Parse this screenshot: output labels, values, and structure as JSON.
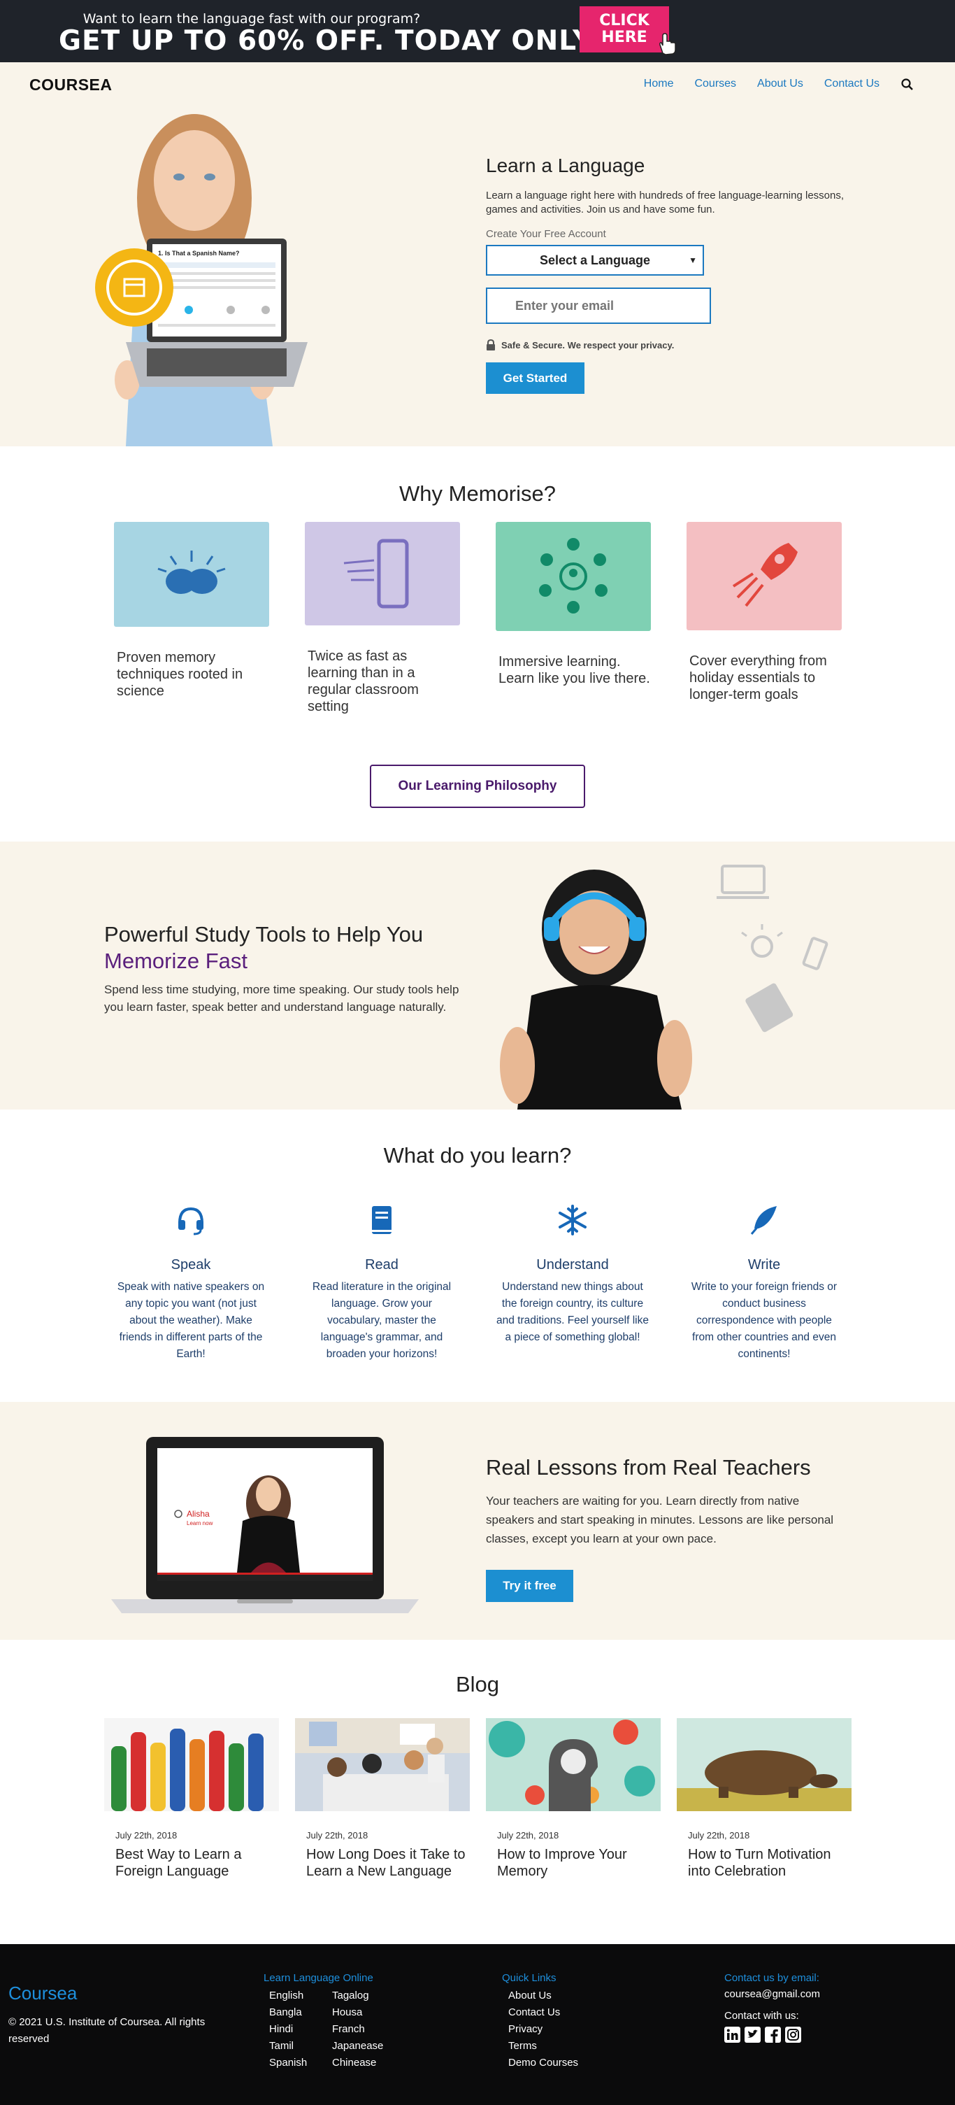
{
  "promo": {
    "subtitle": "Want to learn the language fast with our program?",
    "headline": "GET UP TO 60% OFF. TODAY ONLY!",
    "cta_line1": "CLICK",
    "cta_line2": "HERE"
  },
  "nav": {
    "logo": "COURSEA",
    "items": [
      {
        "label": "Home"
      },
      {
        "label": "Courses"
      },
      {
        "label": "About Us"
      },
      {
        "label": "Contact Us"
      }
    ]
  },
  "hero": {
    "title": "Learn a Language",
    "description": "Learn a language right here with hundreds of free language-learning lessons, games and activities. Join us and have some fun.",
    "create_label": "Create Your Free Account",
    "select_value": "Select a Language",
    "email_placeholder": "Enter your email",
    "safe_text": "Safe & Secure. We respect your privacy.",
    "button": "Get Started",
    "laptop_question": "1. Is That a Spanish Name?"
  },
  "why": {
    "title": "Why Memorise?",
    "cards": [
      {
        "text": "Proven memory techniques rooted in science",
        "color": "#a7d5e3"
      },
      {
        "text": "Twice as fast as learning than in a regular classroom setting",
        "color": "#cfc7e6"
      },
      {
        "text": "Immersive learning. Learn like you live there.",
        "color": "#7fd0b3"
      },
      {
        "text": "Cover everything from holiday essentials to longer-term goals",
        "color": "#f4bfc2"
      }
    ],
    "button": "Our Learning Philosophy"
  },
  "study": {
    "title_line1": "Powerful Study Tools to Help You",
    "title_line2": "Memorize Fast",
    "description": "Spend less time studying, more time speaking. Our study tools help you learn faster, speak better and understand language naturally."
  },
  "learn": {
    "title": "What do you learn?",
    "items": [
      {
        "title": "Speak",
        "text": "Speak with native speakers on any topic you want (not just about the weather). Make friends in different parts of the Earth!",
        "icon": "headset-icon"
      },
      {
        "title": "Read",
        "text": "Read literature in the original language. Grow your vocabulary, master the language's grammar, and broaden your horizons!",
        "icon": "book-icon"
      },
      {
        "title": "Understand",
        "text": "Understand new things about the foreign country, its culture and traditions. Feel yourself like a piece of something global!",
        "icon": "snowflake-icon"
      },
      {
        "title": "Write",
        "text": "Write to your foreign friends or conduct business correspondence with people from other countries and even continents!",
        "icon": "feather-icon"
      }
    ]
  },
  "teach": {
    "title": "Real Lessons from Real Teachers",
    "description": "Your teachers are waiting for you. Learn directly from native speakers and start speaking in minutes. Lessons are like personal classes, except you learn at your own pace.",
    "button": "Try it free",
    "video_label": "Alisha",
    "video_sublabel": "Learn now"
  },
  "blog": {
    "title": "Blog",
    "posts": [
      {
        "date": "July 22th, 2018",
        "title": "Best Way to Learn a Foreign Language"
      },
      {
        "date": "July 22th, 2018",
        "title": "How Long Does it Take to Learn a New Language"
      },
      {
        "date": "July 22th, 2018",
        "title": "How to Improve Your Memory"
      },
      {
        "date": "July 22th, 2018",
        "title": "How to Turn Motivation into Celebration"
      }
    ]
  },
  "footer": {
    "brand": "Coursea",
    "copyright": "© 2021 U.S. Institute of Coursea. All rights reserved",
    "col1_title": "Learn Language Online",
    "col1a": [
      "English",
      "Bangla",
      "Hindi",
      "Tamil",
      "Spanish"
    ],
    "col1b": [
      "Tagalog",
      "Housa",
      "Franch",
      "Japanease",
      "Chinease"
    ],
    "col2_title": "Quick Links",
    "col2": [
      "About Us",
      "Contact Us",
      "Privacy",
      "Terms",
      "Demo Courses"
    ],
    "col3_title": "Contact us by email:",
    "email": "coursea@gmail.com",
    "contact_with": "Contact with us:",
    "socials": [
      "linkedin-icon",
      "twitter-icon",
      "facebook-icon",
      "instagram-icon"
    ]
  }
}
